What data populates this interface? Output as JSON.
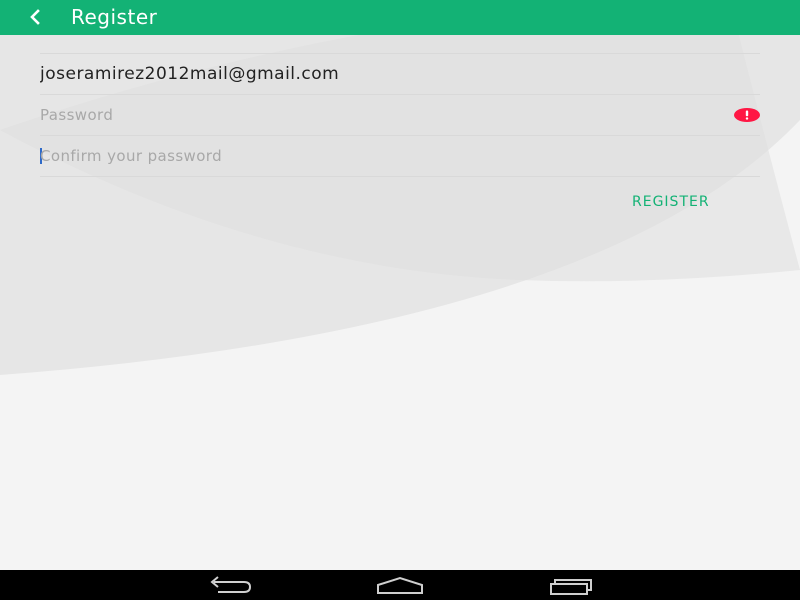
{
  "colors": {
    "accent": "#13b275",
    "appbar_text": "#ffffff",
    "error": "#ff1744",
    "input_text": "#222222",
    "placeholder": "#a8a8a8",
    "divider": "#d9d9d9",
    "caret": "#2f6ac8",
    "navbar": "#000000",
    "navbar_icon": "#cfcfcf",
    "background": "#f4f4f4",
    "background_arc": "#e6e6e6"
  },
  "appbar": {
    "title": "Register",
    "back_icon": "chevron-left-icon"
  },
  "form": {
    "email": {
      "value": "joseramirez2012mail@gmail.com"
    },
    "password": {
      "value": "",
      "placeholder": "Password",
      "error_icon": "alert-circle-icon"
    },
    "confirm": {
      "value": "",
      "placeholder": "Confirm your password"
    },
    "register_label": "REGISTER"
  },
  "navbar": {
    "back_icon": "back-arrow-icon",
    "home_icon": "home-icon",
    "recents_icon": "recent-apps-icon"
  }
}
